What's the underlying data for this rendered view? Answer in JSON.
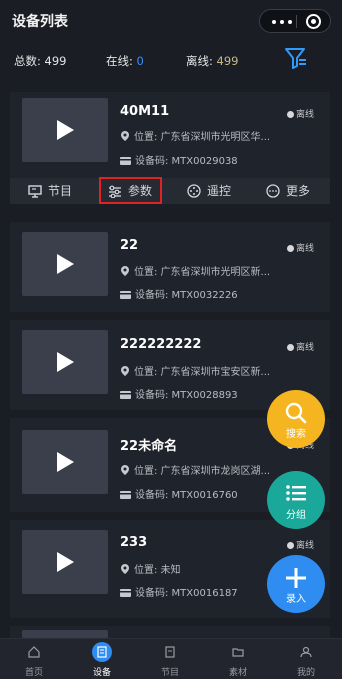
{
  "header": {
    "title": "设备列表"
  },
  "stats": {
    "total_label": "总数:",
    "total_value": "499",
    "online_label": "在线:",
    "online_value": "0",
    "offline_label": "离线:",
    "offline_value": "499"
  },
  "actions": [
    {
      "label": "节目",
      "icon": "program-icon"
    },
    {
      "label": "参数",
      "icon": "sliders-icon"
    },
    {
      "label": "遥控",
      "icon": "remote-icon"
    },
    {
      "label": "更多",
      "icon": "more-icon"
    }
  ],
  "devices": [
    {
      "name": "40M11",
      "status": "离线",
      "location": "位置: 广东省深圳市光明区华...",
      "code": "设备码: MTX0029038"
    },
    {
      "name": "22",
      "status": "离线",
      "location": "位置: 广东省深圳市光明区新...",
      "code": "设备码: MTX0032226"
    },
    {
      "name": "222222222",
      "status": "离线",
      "location": "位置: 广东省深圳市宝安区新...",
      "code": "设备码: MTX0028893"
    },
    {
      "name": "22未命名",
      "status": "离线",
      "location": "位置: 广东省深圳市龙岗区湖...",
      "code": "设备码: MTX0016760"
    },
    {
      "name": "233",
      "status": "离线",
      "location": "位置: 未知",
      "code": "设备码: MTX0016187"
    }
  ],
  "fabs": {
    "search": "搜索",
    "group": "分组",
    "entry": "录入"
  },
  "tabs": [
    {
      "label": "首页",
      "icon": "home-icon"
    },
    {
      "label": "设备",
      "icon": "device-icon"
    },
    {
      "label": "节目",
      "icon": "program-icon"
    },
    {
      "label": "素材",
      "icon": "folder-icon"
    },
    {
      "label": "我的",
      "icon": "user-icon"
    }
  ],
  "colors": {
    "online": "#3b8cff",
    "search_fab": "#f4b520",
    "group_fab": "#1aa89a",
    "entry_fab": "#2f8cf0",
    "highlight": "#e02222"
  }
}
